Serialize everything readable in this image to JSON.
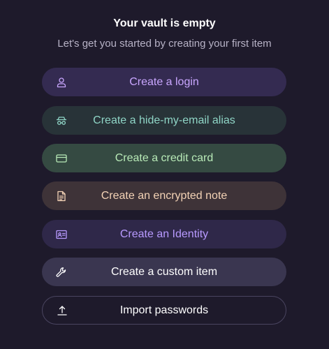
{
  "empty_state": {
    "title": "Your vault is empty",
    "subtitle": "Let's get you started by creating your first item"
  },
  "actions": [
    {
      "label": "Create a login",
      "icon": "user-icon",
      "color": "#c9a6ff",
      "background": "#342b51"
    },
    {
      "label": "Create a hide-my-email alias",
      "icon": "alias-mask-icon",
      "color": "#8fd5c6",
      "background": "#283338"
    },
    {
      "label": "Create a credit card",
      "icon": "credit-card-icon",
      "color": "#b8eab7",
      "background": "#354a42"
    },
    {
      "label": "Create an encrypted note",
      "icon": "note-icon",
      "color": "#f4d3b6",
      "background": "#3e3338"
    },
    {
      "label": "Create an Identity",
      "icon": "id-card-icon",
      "color": "#b89aff",
      "background": "#2f2849"
    },
    {
      "label": "Create a custom item",
      "icon": "wrench-icon",
      "color": "#ffffff",
      "background": "#3a3650"
    },
    {
      "label": "Import passwords",
      "icon": "upload-icon",
      "color": "#ffffff",
      "background": "transparent"
    }
  ],
  "background_color": "#1e1a2b"
}
